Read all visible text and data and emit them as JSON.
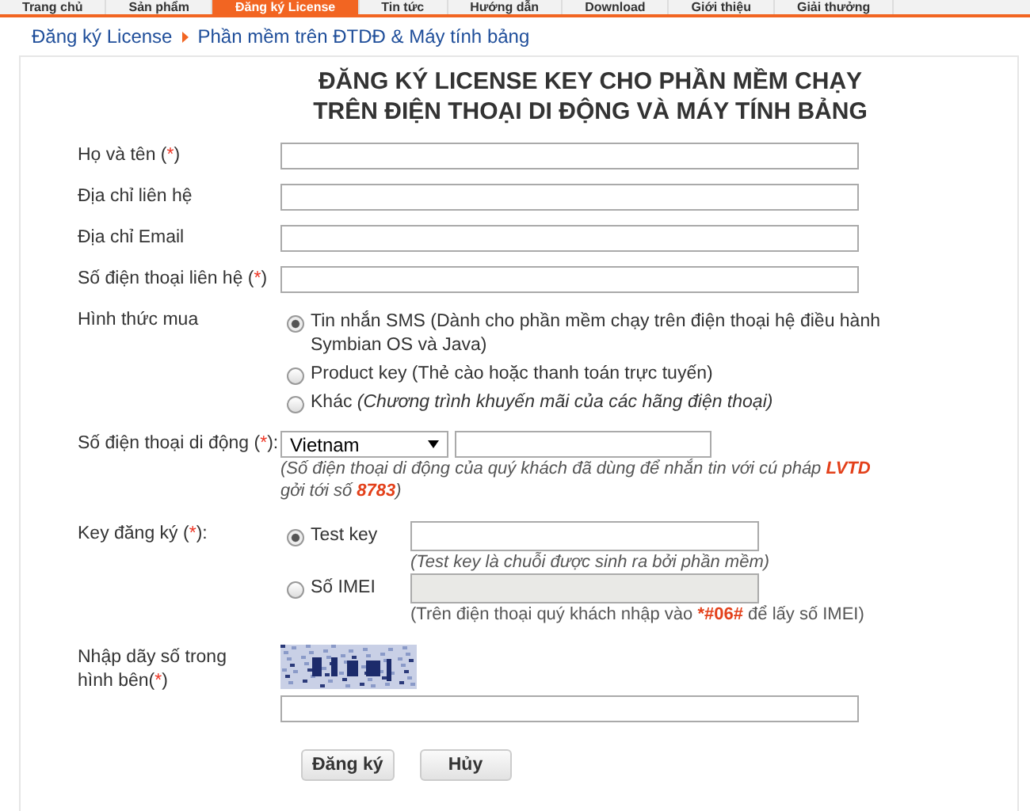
{
  "nav": [
    {
      "label": "Trang chủ",
      "selected": false
    },
    {
      "label": "Sản phẩm",
      "selected": false
    },
    {
      "label": "Đăng ký License",
      "selected": true
    },
    {
      "label": "Tin tức",
      "selected": false
    },
    {
      "label": "Hướng dẫn",
      "selected": false
    },
    {
      "label": "Download",
      "selected": false
    },
    {
      "label": "Giới thiệu",
      "selected": false
    },
    {
      "label": "Giải thưởng",
      "selected": false
    }
  ],
  "breadcrumb": [
    "Đăng ký License",
    "Phần mềm trên ĐTDĐ & Máy tính bảng"
  ],
  "title": [
    "ĐĂNG KÝ LICENSE KEY CHO PHẦN MỀM CHẠY",
    "TRÊN ĐIỆN THOẠI DI ĐỘNG VÀ MÁY TÍNH BẢNG"
  ],
  "rows": [
    {
      "kind": "text",
      "label": [
        {
          "text": "Họ và tên (",
          "em": false
        },
        {
          "text": "*",
          "em": true
        },
        {
          "text": ")",
          "em": false
        }
      ]
    },
    {
      "kind": "text",
      "label": [
        {
          "text": "Địa chỉ liên hệ",
          "em": false
        }
      ]
    },
    {
      "kind": "text",
      "label": [
        {
          "text": "Địa chỉ Email",
          "em": false
        }
      ]
    },
    {
      "kind": "text",
      "label": [
        {
          "text": "Số điện thoại liên hệ (",
          "em": false
        },
        {
          "text": "*",
          "em": true
        },
        {
          "text": ")",
          "em": false
        }
      ]
    },
    {
      "kind": "radios",
      "label": [
        {
          "text": "Hình thức mua",
          "em": false
        }
      ],
      "options": [
        {
          "selected": true,
          "text": "Tin nhắn SMS (Dành cho phần mềm chạy trên điện thoại hệ điều hành Symbian OS và Java)"
        },
        {
          "selected": false,
          "text": "Product key (Thẻ cào hoặc thanh toán trực tuyến)"
        },
        {
          "selected": false,
          "text": "Khác",
          "note": "(Chương trình khuyến mãi của các hãng điện thoại)"
        }
      ]
    },
    {
      "kind": "phone",
      "label": [
        {
          "text": "Số điện thoại di động (",
          "em": false
        },
        {
          "text": "*",
          "em": true
        },
        {
          "text": "):",
          "em": false
        }
      ],
      "country": "Vietnam",
      "hint": [
        {
          "text": "(Số điện thoại di động của quý khách đã dùng để nhắn tin với cú pháp ",
          "em": false
        },
        {
          "text": "LVTD",
          "em": true
        },
        {
          "text": " gởi tới số ",
          "em": false
        },
        {
          "text": "8783",
          "em": true
        },
        {
          "text": ")",
          "em": false
        }
      ]
    },
    {
      "kind": "key",
      "label": [
        {
          "text": "Key đăng ký (",
          "em": false
        },
        {
          "text": "*",
          "em": true
        },
        {
          "text": "):",
          "em": false
        }
      ],
      "options": [
        {
          "selected": true,
          "text": "Test key",
          "disabled": false,
          "hint": [
            {
              "text": "(Test key là chuỗi được sinh ra bởi phần mềm)",
              "em": false
            }
          ],
          "italic": true
        },
        {
          "selected": false,
          "text": "Số IMEI",
          "disabled": true,
          "hint": [
            {
              "text": "(Trên điện thoại quý khách nhập vào ",
              "em": false
            },
            {
              "text": "*#06#",
              "em": true
            },
            {
              "text": " để lấy số IMEI)",
              "em": false
            }
          ],
          "italic": false
        }
      ]
    },
    {
      "kind": "captcha",
      "label": [
        {
          "text": "Nhập dãy số trong hình bên(",
          "em": false
        },
        {
          "text": "*",
          "em": true
        },
        {
          "text": ")",
          "em": false
        }
      ]
    }
  ],
  "buttons": [
    "Đăng ký",
    "Hủy"
  ]
}
